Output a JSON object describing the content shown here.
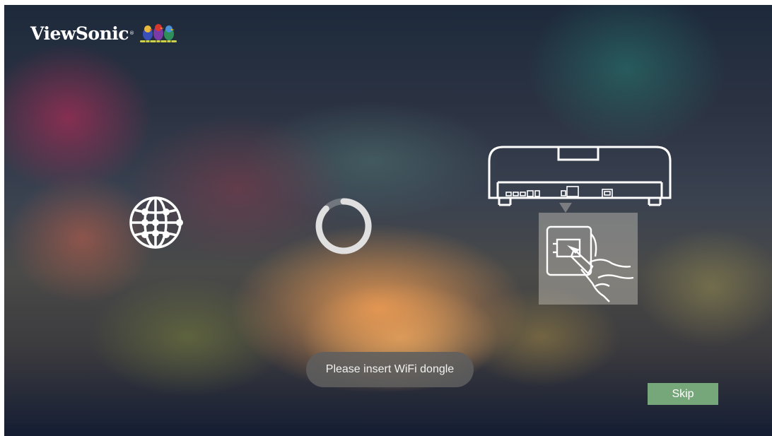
{
  "brand": {
    "name": "ViewSonic",
    "registered_mark": "®"
  },
  "setup": {
    "status_icon": "globe-network-icon",
    "progress_indicator": "loading-spinner",
    "illustration": "projector-usb-dongle-illustration",
    "message": "Please insert WiFi dongle",
    "skip_label": "Skip"
  },
  "colors": {
    "skip_button": "#76a77a",
    "toast_background": "#5f5f5f",
    "text": "#ffffff"
  }
}
